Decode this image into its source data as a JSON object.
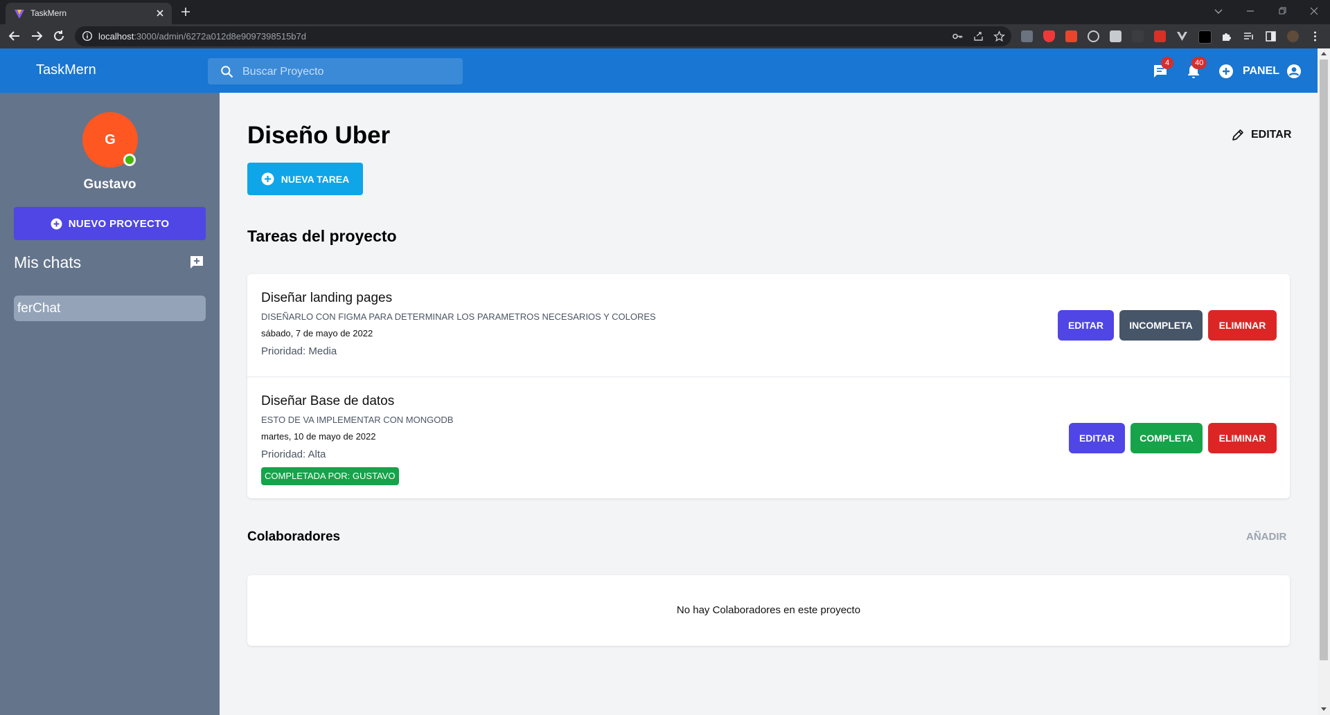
{
  "browser": {
    "tab_title": "TaskMern",
    "url_host": "localhost",
    "url_rest": ":3000/admin/6272a012d8e9097398515b7d"
  },
  "header": {
    "brand": "TaskMern",
    "search_placeholder": "Buscar Proyecto",
    "messages_badge": "4",
    "notifications_badge": "40",
    "panel_label": "PANEL"
  },
  "sidebar": {
    "avatar_initial": "G",
    "user_name": "Gustavo",
    "new_project_label": "NUEVO PROYECTO",
    "chats_title": "Mis chats",
    "chats": [
      "ferChat"
    ]
  },
  "main": {
    "project_title": "Diseño Uber",
    "edit_label": "EDITAR",
    "new_task_label": "NUEVA TAREA",
    "tasks_title": "Tareas del proyecto",
    "tasks": [
      {
        "name": "Diseñar landing pages",
        "description": "DISEÑARLO CON FIGMA PARA DETERMINAR LOS PARAMETROS NECESARIOS Y COLORES",
        "date": "sábado, 7 de mayo de 2022",
        "priority": "Prioridad: Media",
        "edit_label": "EDITAR",
        "status_label": "INCOMPLETA",
        "delete_label": "ELIMINAR"
      },
      {
        "name": "Diseñar Base de datos",
        "description": "ESTO DE VA IMPLEMENTAR CON MONGODB",
        "date": "martes, 10 de mayo de 2022",
        "priority": "Prioridad: Alta",
        "completed_by": "COMPLETADA POR: GUSTAVO",
        "edit_label": "EDITAR",
        "status_label": "COMPLETA",
        "delete_label": "ELIMINAR"
      }
    ],
    "collaborators_title": "Colaboradores",
    "add_label": "AÑADIR",
    "no_collaborators": "No hay Colaboradores en este proyecto"
  },
  "colors": {
    "header": "#1976d2",
    "sidebar": "#64748b",
    "indigo": "#4f46e5",
    "sky": "#0ea5e9",
    "slate": "#475569",
    "red": "#dc2626",
    "green": "#16a34a",
    "avatar": "#ff5722"
  }
}
